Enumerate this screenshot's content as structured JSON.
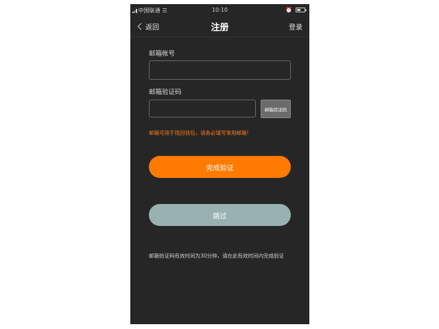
{
  "status_bar": {
    "carrier": "中国联通",
    "time": "10:10",
    "icons": [
      "signal-icon",
      "wifi-icon",
      "alarm-icon",
      "battery-icon"
    ]
  },
  "nav": {
    "back_label": "返回",
    "title": "注册",
    "login_label": "登录"
  },
  "form": {
    "email_label": "邮箱帐号",
    "email_value": "",
    "code_label": "邮箱验证码",
    "code_value": "",
    "get_code_label": "邮箱验证码",
    "hint": "邮箱可用于找回钱包，请务必填写常用邮箱!",
    "submit_label": "完成验证",
    "skip_label": "跳过"
  },
  "footer": {
    "note": "邮箱验证码有效时间为30分钟，请在此有效时间内完成验证"
  },
  "colors": {
    "background": "#262626",
    "accent": "#ff7a00",
    "hint_text": "#ff7a1a",
    "skip_button": "#9ab1b1",
    "code_button": "#6b6b6b"
  }
}
